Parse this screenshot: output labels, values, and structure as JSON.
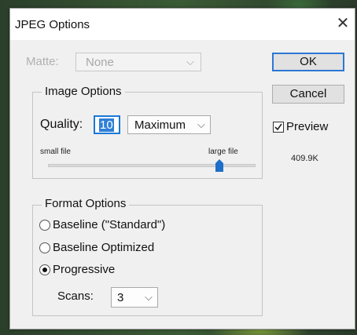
{
  "dialog": {
    "title": "JPEG Options",
    "close_glyph": "✕"
  },
  "matte": {
    "label": "Matte:",
    "value": "None",
    "icon": "chevron-down-icon"
  },
  "buttons": {
    "ok": "OK",
    "cancel": "Cancel"
  },
  "preview": {
    "label": "Preview",
    "checked": true,
    "size": "409.9K"
  },
  "image_options": {
    "legend": "Image Options",
    "quality_label": "Quality:",
    "quality_value": "10",
    "quality_preset": "Maximum",
    "slider_min_label": "small file",
    "slider_max_label": "large file",
    "slider_level": 0.83,
    "icon": "chevron-down-icon"
  },
  "format_options": {
    "legend": "Format Options",
    "options": [
      {
        "label": "Baseline (\"Standard\")",
        "selected": false
      },
      {
        "label": "Baseline Optimized",
        "selected": false
      },
      {
        "label": "Progressive",
        "selected": true
      }
    ],
    "scans_label": "Scans:",
    "scans_value": "3"
  },
  "colors": {
    "accent": "#1a78d8",
    "slider_thumb": "#1d6fc7"
  }
}
